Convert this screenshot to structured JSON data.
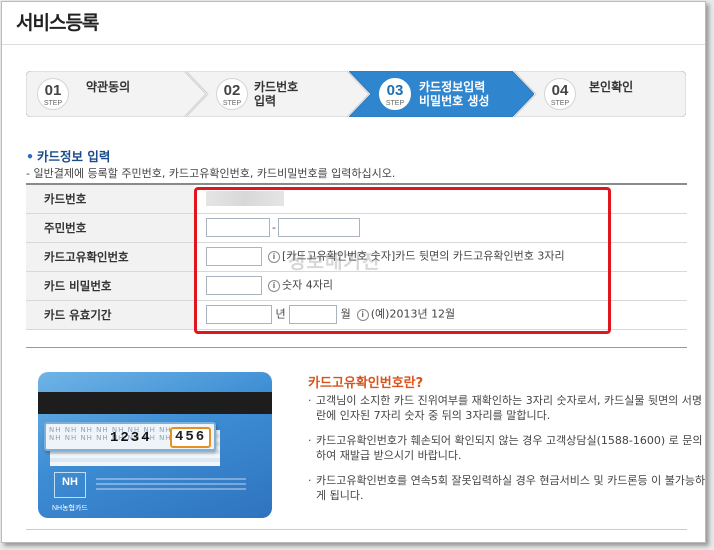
{
  "page": {
    "title": "서비스등록"
  },
  "steps": [
    {
      "num": "01",
      "step_label": "STEP",
      "line1": "약관동의",
      "line2": "",
      "active": false
    },
    {
      "num": "02",
      "step_label": "STEP",
      "line1": "카드번호",
      "line2": "입력",
      "active": false
    },
    {
      "num": "03",
      "step_label": "STEP",
      "line1": "카드정보입력",
      "line2": "비밀번호 생성",
      "active": true
    },
    {
      "num": "04",
      "step_label": "STEP",
      "line1": "본인확인",
      "line2": "",
      "active": false
    }
  ],
  "section": {
    "title": "카드정보 입력",
    "description": "- 일반결제에 등록할 주민번호, 카드고유확인번호, 카드비밀번호를 입력하십시오."
  },
  "form": {
    "card_number_label": "카드번호",
    "resident_label": "주민번호",
    "resident_sep": "-",
    "cvc_label": "카드고유확인번호",
    "cvc_help": "[카드고유확인번호 숫자]카드 뒷면의 카드고유확인번호 3자리",
    "pw_label": "카드 비밀번호",
    "pw_help": "숫자 4자리",
    "expiry_label": "카드 유효기간",
    "year_unit": "년",
    "month_unit": "월",
    "expiry_help": "(예)2013년 12월",
    "info_glyph": "i"
  },
  "watermark": "정보매거진",
  "card_illustration": {
    "logo": "NH",
    "brand": "NH농협카드",
    "zoom_bg": "NH  NH  NH  NH  NH  NH  NH  NH  NH  NH",
    "digits": "1234",
    "cvc": "456"
  },
  "help": {
    "title": "카드고유확인번호란?",
    "bullet": "·",
    "items": [
      "고객님이 소지한 카드 진위여부를 재확인하는 3자리 숫자로서, 카드실물 뒷면의 서명란에 인자된 7자리 숫자 중 뒤의 3자리를 말합니다.",
      "카드고유확인번호가 훼손되어 확인되지 않는 경우 고객상담실(1588-1600) 로 문의하여 재발급 받으시기 바랍니다.",
      "카드고유확인번호를 연속5회 잘못입력하실 경우 현금서비스 및 카드론등 이 불가능하게 됩니다."
    ]
  },
  "colors": {
    "active_step": "#2f86cf",
    "inactive_step": "#f2f2f2",
    "highlight": "#e0161f",
    "help_title": "#d9541c"
  }
}
